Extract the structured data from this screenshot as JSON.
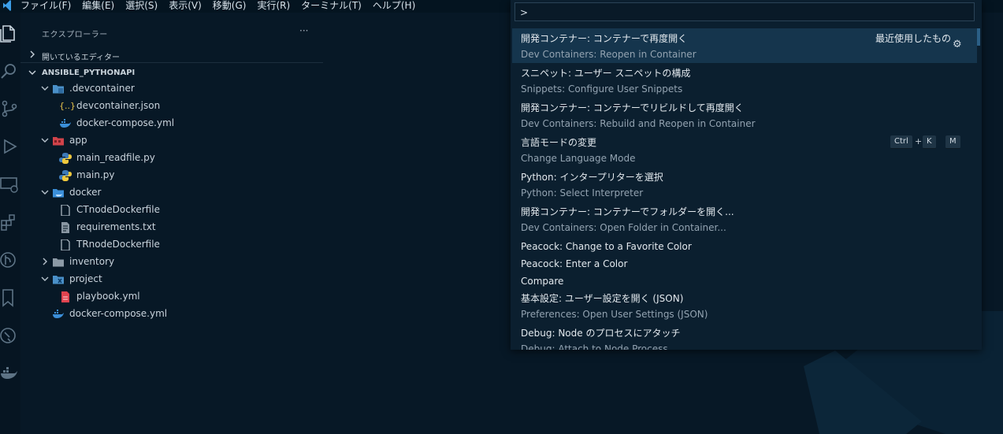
{
  "menubar": {
    "items": [
      "ファイル(F)",
      "編集(E)",
      "選択(S)",
      "表示(V)",
      "移動(G)",
      "実行(R)",
      "ターミナル(T)",
      "ヘルプ(H)"
    ]
  },
  "sidebar": {
    "title": "エクスプローラー",
    "more": "···",
    "open_editors": "開いているエディター",
    "project_name": "ANSIBLE_PYTHONAPI",
    "tree": [
      {
        "name": ".devcontainer",
        "kind": "folder-open"
      },
      {
        "name": "devcontainer.json",
        "kind": "json"
      },
      {
        "name": "docker-compose.yml",
        "kind": "docker"
      },
      {
        "name": "app",
        "kind": "folder-open"
      },
      {
        "name": "main_readfile.py",
        "kind": "python"
      },
      {
        "name": "main.py",
        "kind": "python"
      },
      {
        "name": "docker",
        "kind": "folder-open"
      },
      {
        "name": "CTnodeDockerfile",
        "kind": "file"
      },
      {
        "name": "requirements.txt",
        "kind": "text"
      },
      {
        "name": "TRnodeDockerfile",
        "kind": "file"
      },
      {
        "name": "inventory",
        "kind": "folder-closed"
      },
      {
        "name": "project",
        "kind": "folder-open"
      },
      {
        "name": "playbook.yml",
        "kind": "yaml"
      },
      {
        "name": "docker-compose.yml",
        "kind": "docker"
      }
    ]
  },
  "palette": {
    "input_value": ">",
    "recent_label": "最近使用したもの",
    "items": [
      {
        "title": "開発コンテナー: コンテナーで再度開く",
        "subtitle": "Dev Containers: Reopen in Container"
      },
      {
        "title": "スニペット: ユーザー スニペットの構成",
        "subtitle": "Snippets: Configure User Snippets"
      },
      {
        "title": "開発コンテナー: コンテナーでリビルドして再度開く",
        "subtitle": "Dev Containers: Rebuild and Reopen in Container"
      },
      {
        "title": "言語モードの変更",
        "subtitle": "Change Language Mode"
      },
      {
        "title": "Python: インタープリターを選択",
        "subtitle": "Python: Select Interpreter"
      },
      {
        "title": "開発コンテナー: コンテナーでフォルダーを開く...",
        "subtitle": "Dev Containers: Open Folder in Container..."
      },
      {
        "title": "Peacock: Change to a Favorite Color"
      },
      {
        "title": "Peacock: Enter a Color"
      },
      {
        "title": "Compare"
      },
      {
        "title": "基本設定: ユーザー設定を開く (JSON)",
        "subtitle": "Preferences: Open User Settings (JSON)"
      },
      {
        "title": "Debug: Node のプロセスにアタッチ",
        "subtitle": "Debug: Attach to Node Process"
      }
    ],
    "keybinding": {
      "key1": "Ctrl",
      "plus": "+",
      "key2": "K",
      "key3": "M"
    }
  },
  "colors": {
    "background": "#071826",
    "selected": "#15354d",
    "accent": "#3c9ee8"
  }
}
